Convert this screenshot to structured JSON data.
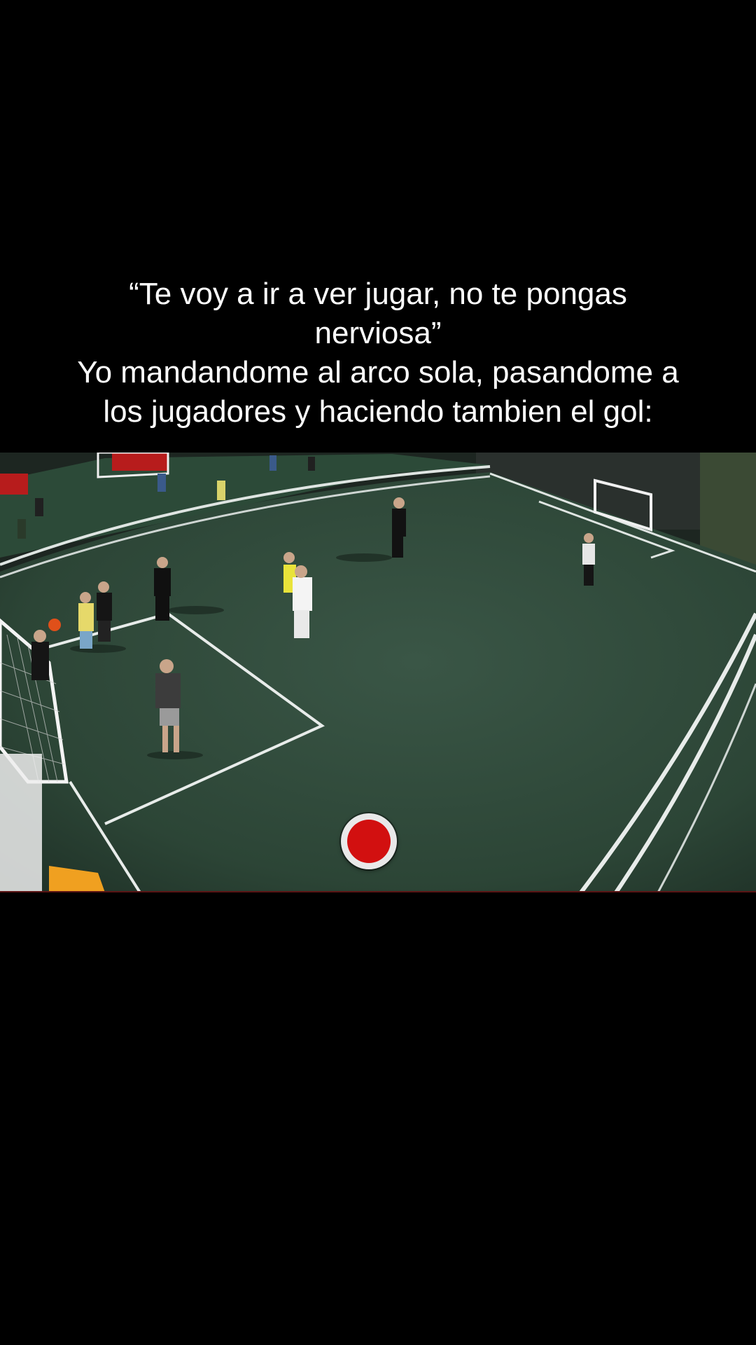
{
  "caption": {
    "lines": [
      "“Te voy a ir a ver jugar, no te pongas",
      "nerviosa”",
      "Yo mandandome al arco sola, pasandome a",
      "los jugadores y haciendo tambien el gol:"
    ]
  },
  "video": {
    "scene": "futsal-field-overhead-camera",
    "pitch_color": "#2f4a3a",
    "line_color": "#e8ecea"
  },
  "controls": {
    "record_button": {
      "icon": "record-icon",
      "color": "#d21010"
    }
  }
}
